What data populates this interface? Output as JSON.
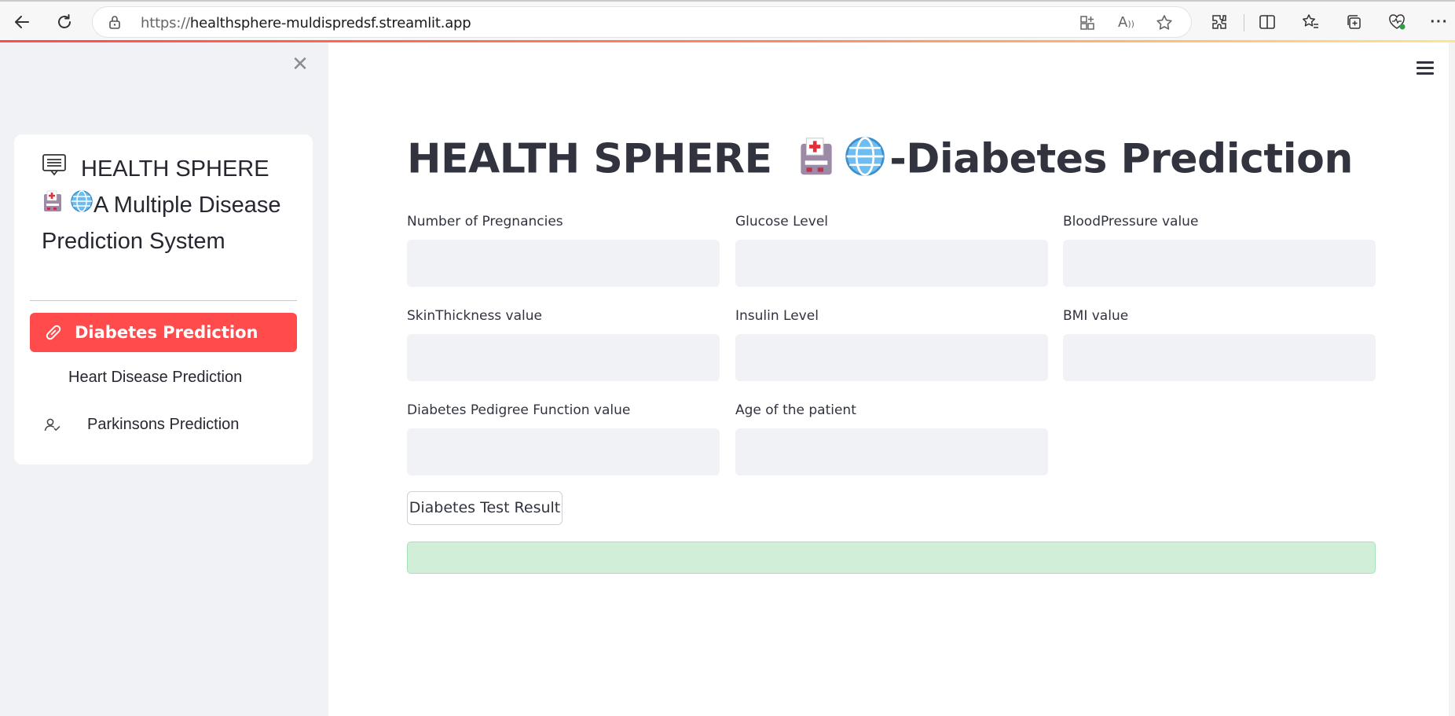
{
  "browser": {
    "url_scheme": "https://",
    "url_host": "healthsphere-muldispredsf.streamlit.app",
    "icons": [
      "back-icon",
      "refresh-icon",
      "lock-icon",
      "app-icon",
      "read-aloud-icon",
      "favorite-star-icon",
      "extensions-icon",
      "split-screen-icon",
      "favorites-icon",
      "collections-icon",
      "browser-essentials-icon",
      "more-icon"
    ]
  },
  "sidebar": {
    "title_part1": "HEALTH SPHERE",
    "title_part2": "A Multiple Disease Prediction System",
    "items": [
      {
        "label": "Diabetes Prediction",
        "icon": "capsule-icon",
        "active": true
      },
      {
        "label": "Heart Disease Prediction",
        "icon": "heart-icon",
        "active": false
      },
      {
        "label": "Parkinsons Prediction",
        "icon": "person-check-icon",
        "active": false
      }
    ],
    "accent_color": "#ff4b4b"
  },
  "main": {
    "title_prefix": "HEALTH SPHERE",
    "title_suffix": "-Diabetes Prediction",
    "fields": [
      {
        "label": "Number of Pregnancies",
        "value": ""
      },
      {
        "label": "Glucose Level",
        "value": ""
      },
      {
        "label": "BloodPressure value",
        "value": ""
      },
      {
        "label": "SkinThickness value",
        "value": ""
      },
      {
        "label": "Insulin Level",
        "value": ""
      },
      {
        "label": "BMI value",
        "value": ""
      },
      {
        "label": "Diabetes Pedigree Function value",
        "value": ""
      },
      {
        "label": "Age of the patient",
        "value": ""
      }
    ],
    "submit_label": "Diabetes Test Result",
    "result_text": "",
    "success_color": "#d1eed9"
  }
}
